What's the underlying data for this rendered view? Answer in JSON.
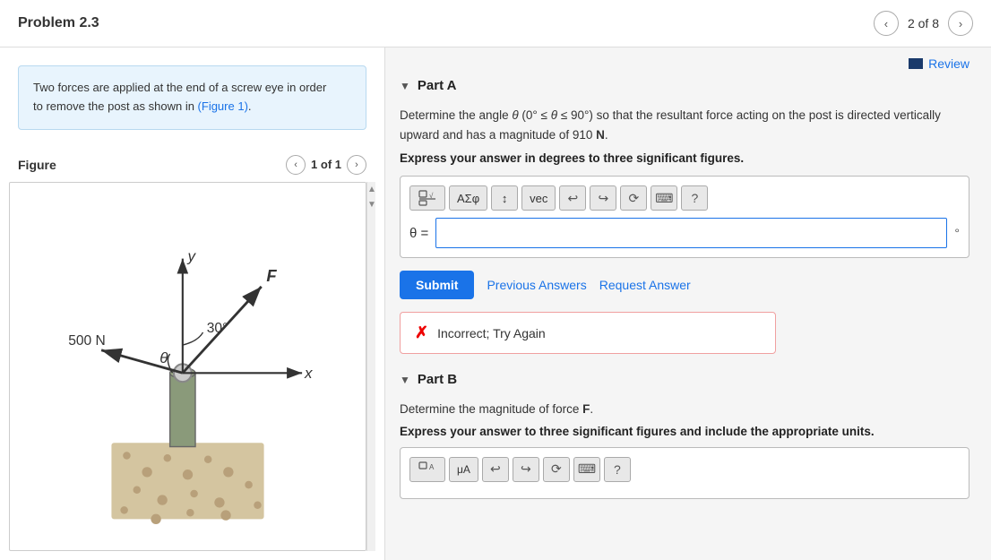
{
  "header": {
    "title": "Problem 2.3",
    "page_indicator": "2 of 8",
    "prev_label": "‹",
    "next_label": "›"
  },
  "left": {
    "problem_text_1": "Two forces are applied at the end of a screw eye in order",
    "problem_text_2": "to remove the post as shown in ",
    "figure_link": "(Figure 1)",
    "problem_text_3": ".",
    "figure_label": "Figure",
    "figure_counter": "1 of 1",
    "fig_prev": "‹",
    "fig_next": "›"
  },
  "right": {
    "review_label": "Review",
    "part_a": {
      "label": "Part A",
      "question_html": "Determine the angle θ (0° ≤ θ ≤ 90°) so that the resultant force acting on the post is directed vertically upward and has a magnitude of 910 N.",
      "express_line": "Express your answer in degrees to three significant figures.",
      "theta_label": "θ =",
      "degree_symbol": "°",
      "submit_label": "Submit",
      "prev_answers_label": "Previous Answers",
      "request_answer_label": "Request Answer",
      "result_text": "Incorrect; Try Again"
    },
    "part_b": {
      "label": "Part B",
      "question_html": "Determine the magnitude of force F.",
      "express_line": "Express your answer to three significant figures and include the appropriate units."
    },
    "toolbar": {
      "btn1": "⬜√□",
      "btn2": "AΣφ",
      "btn3": "↕",
      "btn4": "vec",
      "btn5": "↩",
      "btn6": "↪",
      "btn7": "⟳",
      "btn8": "⌨",
      "btn9": "?"
    }
  }
}
